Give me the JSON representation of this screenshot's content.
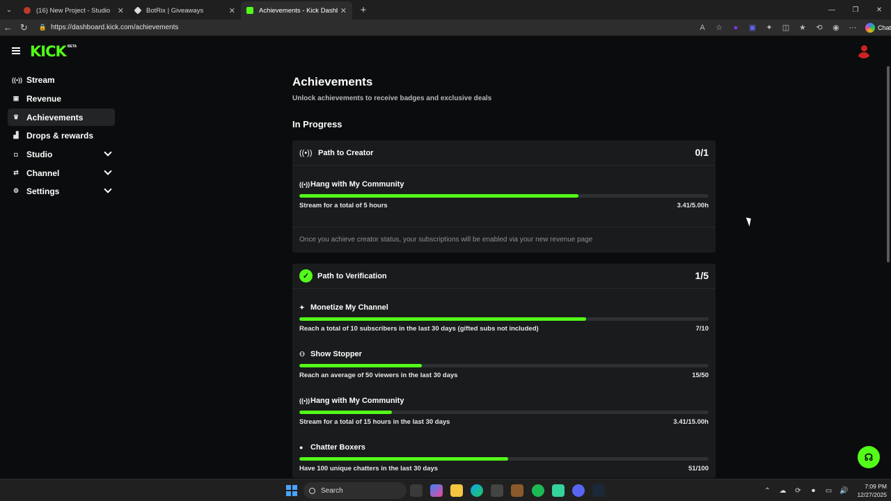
{
  "browser": {
    "tabs": [
      {
        "title": "(16) New Project - Studio",
        "color": "#c0392b"
      },
      {
        "title": "BotRix | Giveaways",
        "color": "#dddddd"
      },
      {
        "title": "Achievements - Kick Dashboard",
        "color": "#53fc18"
      }
    ],
    "url": "https://dashboard.kick.com/achievements",
    "chat_label": "Chat"
  },
  "brand": {
    "logo_text": "KICK",
    "beta": "BETA",
    "accent": "#53fc18"
  },
  "sidebar": {
    "items": [
      {
        "label": "Stream",
        "icon": "broadcast-icon",
        "glyph": "(•)",
        "chevron": false,
        "active": false
      },
      {
        "label": "Revenue",
        "icon": "revenue-icon",
        "glyph": "▣",
        "chevron": false,
        "active": false
      },
      {
        "label": "Achievements",
        "icon": "trophy-icon",
        "glyph": "🏆",
        "chevron": false,
        "active": true
      },
      {
        "label": "Drops & rewards",
        "icon": "drops-icon",
        "glyph": "▟",
        "chevron": false,
        "active": false
      },
      {
        "label": "Studio",
        "icon": "studio-icon",
        "glyph": "◘",
        "chevron": true,
        "active": false
      },
      {
        "label": "Channel",
        "icon": "channel-icon",
        "glyph": "⇄",
        "chevron": true,
        "active": false
      },
      {
        "label": "Settings",
        "icon": "gear-icon",
        "glyph": "⚙",
        "chevron": true,
        "active": false
      }
    ]
  },
  "main": {
    "title": "Achievements",
    "subtitle": "Unlock achievements to receive badges and exclusive deals",
    "section_title": "In Progress",
    "cards": [
      {
        "title": "Path to Creator",
        "score": "0/1",
        "achievements": [
          {
            "name": "Hang with My Community",
            "desc": "Stream for a total of 5 hours",
            "value": "3.41/5.00h",
            "progress": 0.682
          }
        ],
        "note": "Once you achieve creator status, your subscriptions will be enabled via your new revenue page"
      },
      {
        "title": "Path to Verification",
        "score": "1/5",
        "achievements": [
          {
            "name": "Monetize My Channel",
            "desc": "Reach a total of 10 subscribers in the last 30 days (gifted subs not included)",
            "value": "7/10",
            "progress": 0.7
          },
          {
            "name": "Show Stopper",
            "desc": "Reach an average of 50 viewers in the last 30 days",
            "value": "15/50",
            "progress": 0.3
          },
          {
            "name": "Hang with My Community",
            "desc": "Stream for a total of 15 hours in the last 30 days",
            "value": "3.41/15.00h",
            "progress": 0.227
          },
          {
            "name": "Chatter Boxers",
            "desc": "Have 100 unique chatters in the last 30 days",
            "value": "51/100",
            "progress": 0.51
          }
        ]
      }
    ]
  },
  "taskbar": {
    "search_label": "Search",
    "time": "7:09 PM",
    "date": "12/27/2025"
  }
}
